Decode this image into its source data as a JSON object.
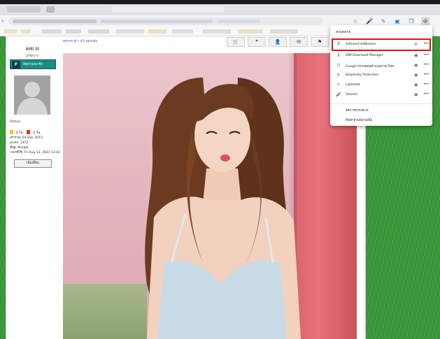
{
  "browser": {
    "toolbar_icons": [
      "star-icon",
      "mic-icon",
      "pen-icon",
      "screenshot-icon",
      "tab-icon",
      "extensions-icon"
    ]
  },
  "profile": {
    "name": "AMI N",
    "role": "ผู้ใช้ทั่วไป",
    "badge": "ติดตามสมาชิก",
    "status_label": "Status:",
    "stat_a": ": 0 โน",
    "stat_b": ": 0 โน",
    "joined": "เข้าร่วม: 01 Dec 2013",
    "posts": "posts: 3372",
    "from": "ที่อยู่: Nurgat",
    "last_visit": "เวลาที่ใช้: Fri Aug 13, 2021 12:42",
    "button": "เพิ่มเพื่อน",
    "colors": {
      "stat_a": "#f5c518",
      "stat_b": "#d9342b"
    }
  },
  "breadcrumb": "ตอบกระทู้ • #2 ตอบกลับ",
  "post_buttons": [
    {
      "name": "cart",
      "glyph": "🛒"
    },
    {
      "name": "quote",
      "glyph": "❞"
    },
    {
      "name": "profile",
      "glyph": "👤"
    },
    {
      "name": "message",
      "glyph": "✉"
    },
    {
      "name": "report",
      "glyph": "⚑"
    }
  ],
  "extensions": {
    "title": "ส่วนขยาย",
    "items": [
      {
        "label": "AdGuard AdBlocker",
        "icon": "shield-icon",
        "glyph": "⛨",
        "color": "#6b6b6b",
        "highlight": true
      },
      {
        "label": "IDM Download Manager",
        "icon": "download-icon",
        "glyph": "⬇",
        "color": "#3f8fd6",
        "highlight": false
      },
      {
        "label": "Google ตรวจสอบคำแปลภาษาไทย",
        "icon": "google-icon",
        "glyph": "G",
        "color": "#4285f4",
        "highlight": false
      },
      {
        "label": "Kaspersky Protection",
        "icon": "kaspersky-icon",
        "glyph": "K",
        "color": "#1a9e5c",
        "highlight": false
      },
      {
        "label": "Lightshot",
        "icon": "feather-icon",
        "glyph": "✎",
        "color": "#8a45d6",
        "highlight": false
      },
      {
        "label": "Volume",
        "icon": "mic-icon",
        "glyph": "🎤",
        "color": "#555555",
        "highlight": false
      }
    ],
    "links": [
      "จัดการส่วนขยาย",
      "ค้นหาส่วนขยายเพิ่ม"
    ]
  }
}
